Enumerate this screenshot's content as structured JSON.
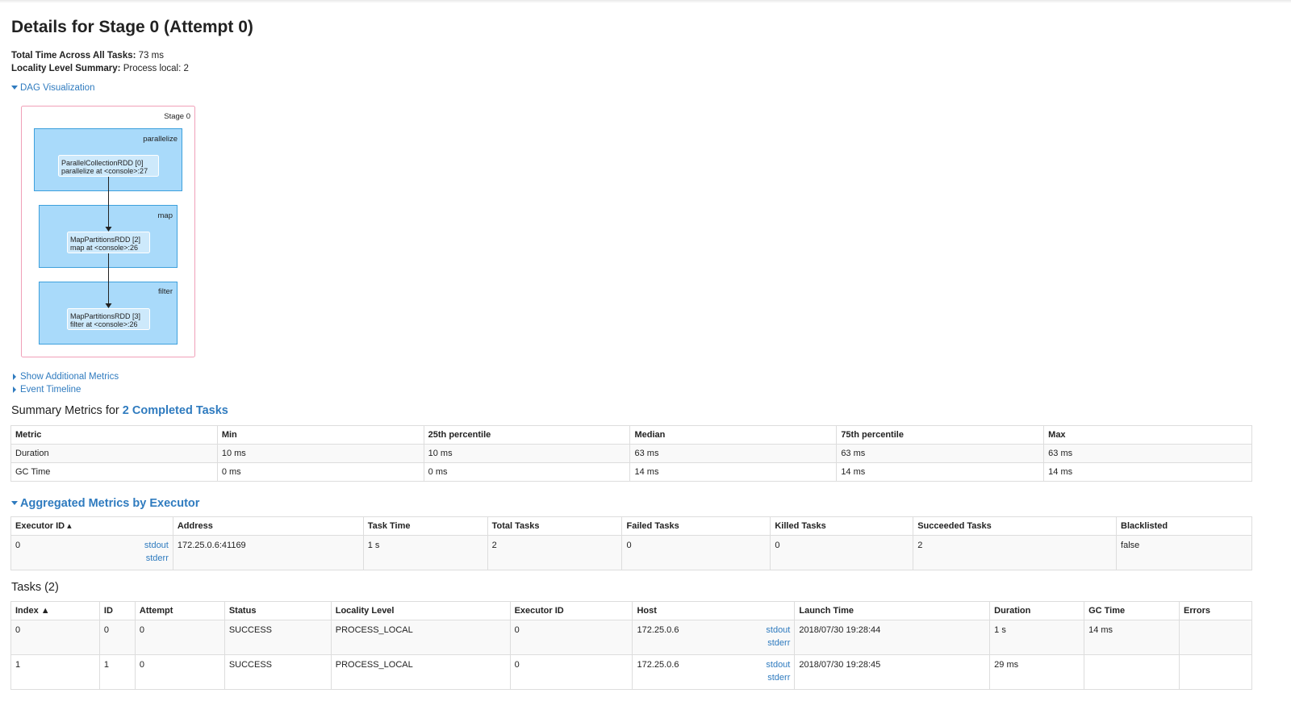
{
  "page_title": "Details for Stage 0 (Attempt 0)",
  "summary": {
    "total_time_label": "Total Time Across All Tasks:",
    "total_time_value": "73 ms",
    "locality_label": "Locality Level Summary:",
    "locality_value": "Process local: 2"
  },
  "dag": {
    "toggle_label": "DAG Visualization",
    "stage_label": "Stage 0",
    "clusters": [
      {
        "name": "parallelize",
        "node_line1": "ParallelCollectionRDD [0]",
        "node_line2": "parallelize at <console>:27"
      },
      {
        "name": "map",
        "node_line1": "MapPartitionsRDD [2]",
        "node_line2": "map at <console>:26"
      },
      {
        "name": "filter",
        "node_line1": "MapPartitionsRDD [3]",
        "node_line2": "filter at <console>:26"
      }
    ],
    "colors": {
      "cluster": "#a9dafa",
      "cluster_border": "#3ea0dc",
      "stage_border": "#f0a0b8"
    }
  },
  "toggles": {
    "additional_metrics": "Show Additional Metrics",
    "event_timeline": "Event Timeline"
  },
  "summary_metrics": {
    "title_prefix": "Summary Metrics for",
    "title_link": "2 Completed Tasks",
    "headers": [
      "Metric",
      "Min",
      "25th percentile",
      "Median",
      "75th percentile",
      "Max"
    ],
    "rows": [
      [
        "Duration",
        "10 ms",
        "10 ms",
        "63 ms",
        "63 ms",
        "63 ms"
      ],
      [
        "GC Time",
        "0 ms",
        "0 ms",
        "14 ms",
        "14 ms",
        "14 ms"
      ]
    ]
  },
  "aggregated": {
    "title": "Aggregated Metrics by Executor",
    "headers": [
      "Executor ID ▴",
      "Address",
      "Task Time",
      "Total Tasks",
      "Failed Tasks",
      "Killed Tasks",
      "Succeeded Tasks",
      "Blacklisted"
    ],
    "row": {
      "executor_id": "0",
      "stdout": "stdout",
      "stderr": "stderr",
      "address": "172.25.0.6:41169",
      "task_time": "1 s",
      "total_tasks": "2",
      "failed_tasks": "0",
      "killed_tasks": "0",
      "succeeded_tasks": "2",
      "blacklisted": "false"
    }
  },
  "tasks": {
    "title": "Tasks (2)",
    "headers": [
      "Index ▲",
      "ID",
      "Attempt",
      "Status",
      "Locality Level",
      "Executor ID",
      "Host",
      "Launch Time",
      "Duration",
      "GC Time",
      "Errors"
    ],
    "rows": [
      {
        "index": "0",
        "id": "0",
        "attempt": "0",
        "status": "SUCCESS",
        "locality": "PROCESS_LOCAL",
        "executor": "0",
        "host": "172.25.0.6",
        "stdout": "stdout",
        "stderr": "stderr",
        "launch": "2018/07/30 19:28:44",
        "duration": "1 s",
        "gc": "14 ms",
        "errors": ""
      },
      {
        "index": "1",
        "id": "1",
        "attempt": "0",
        "status": "SUCCESS",
        "locality": "PROCESS_LOCAL",
        "executor": "0",
        "host": "172.25.0.6",
        "stdout": "stdout",
        "stderr": "stderr",
        "launch": "2018/07/30 19:28:45",
        "duration": "29 ms",
        "gc": "",
        "errors": ""
      }
    ]
  }
}
